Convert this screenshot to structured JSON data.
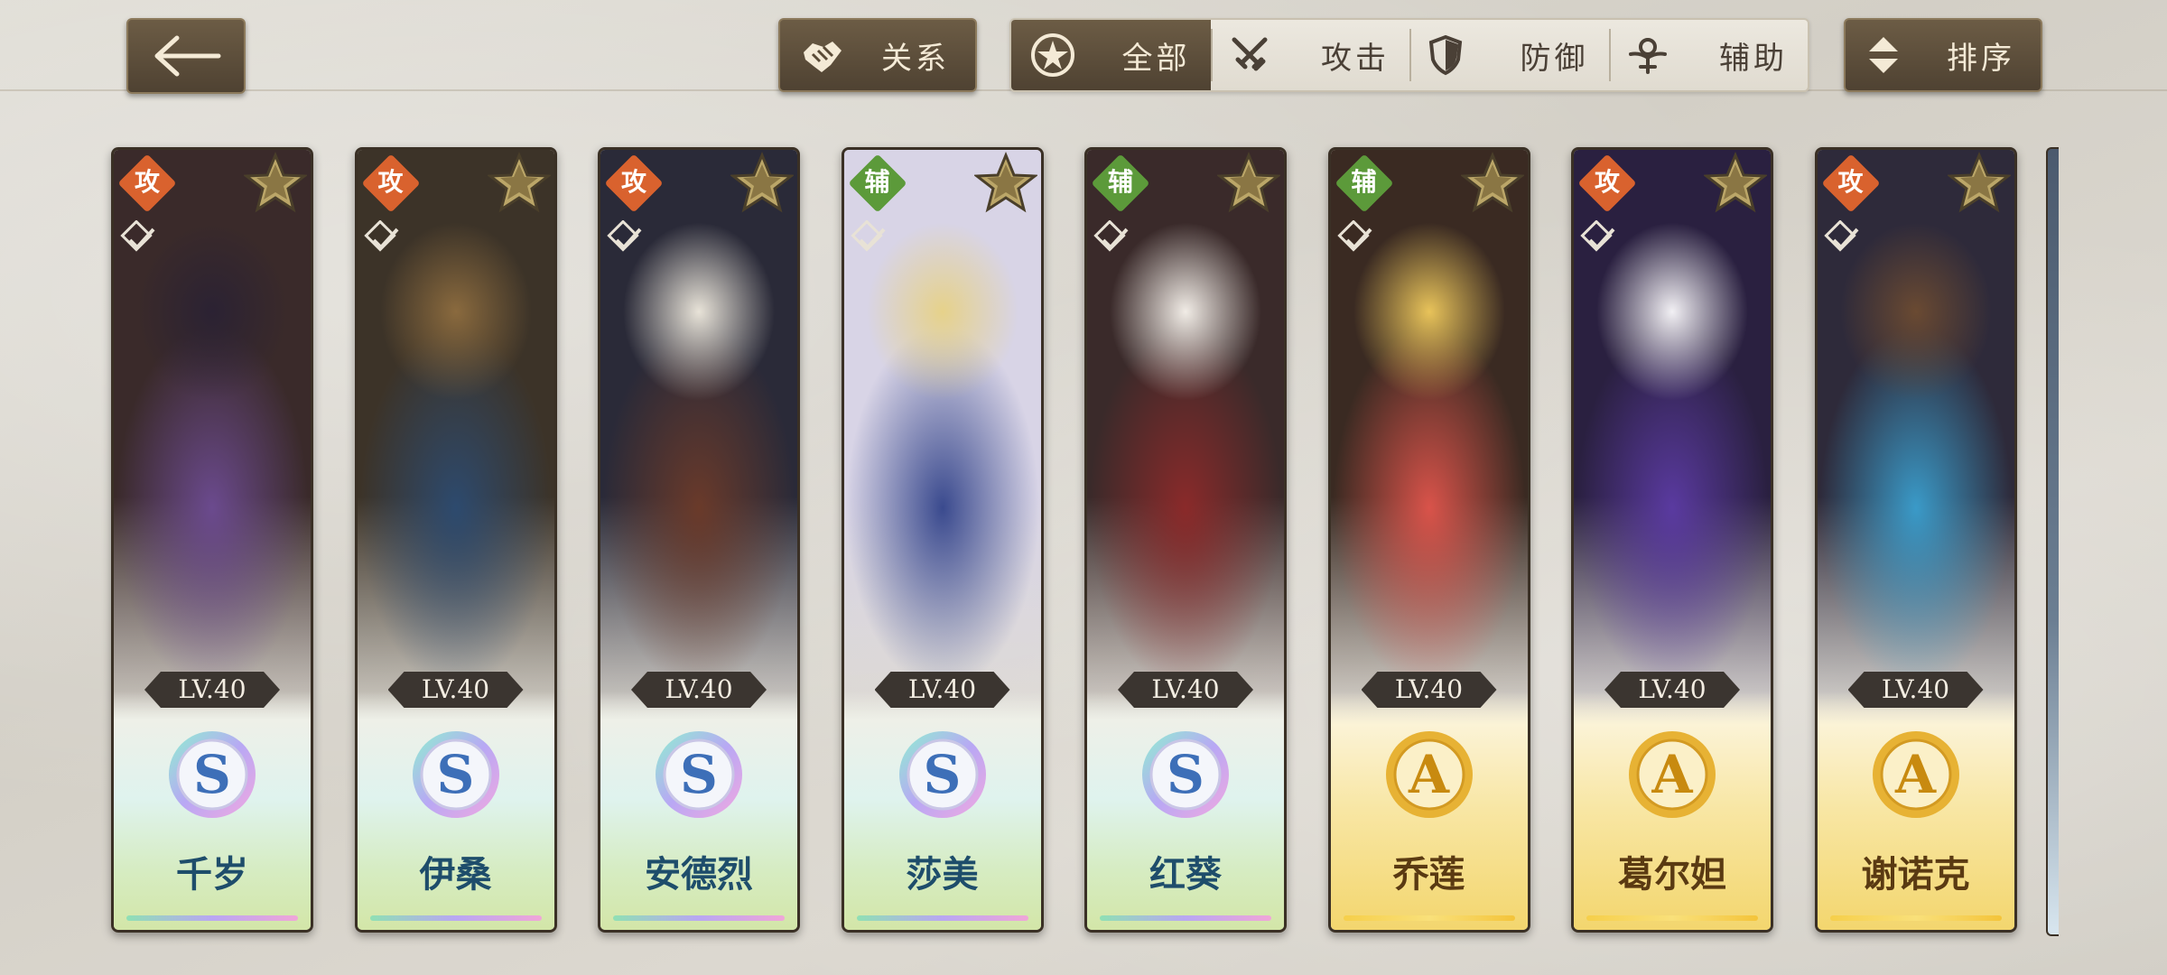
{
  "toolbar": {
    "relation_label": "关系",
    "sort_label": "排序",
    "filters": [
      {
        "label": "全部",
        "icon": "star-circle-icon",
        "active": true
      },
      {
        "label": "攻击",
        "icon": "crossed-swords-icon",
        "active": false
      },
      {
        "label": "防御",
        "icon": "shield-icon",
        "active": false
      },
      {
        "label": "辅助",
        "icon": "support-emblem-icon",
        "active": false
      }
    ]
  },
  "characters": [
    {
      "name": "千岁",
      "level": "LV.40",
      "type": "攻",
      "rank": "S",
      "art_colors": [
        "#3a2a2a",
        "#6b4a8e",
        "#2b2233"
      ]
    },
    {
      "name": "伊桑",
      "level": "LV.40",
      "type": "攻",
      "rank": "S",
      "art_colors": [
        "#3c3328",
        "#2d4a6e",
        "#8a6a3e"
      ]
    },
    {
      "name": "安德烈",
      "level": "LV.40",
      "type": "攻",
      "rank": "S",
      "art_colors": [
        "#2a2a38",
        "#6a3a2a",
        "#e8e3d8"
      ]
    },
    {
      "name": "莎美",
      "level": "LV.40",
      "type": "辅",
      "rank": "S",
      "art_colors": [
        "#d8d4e6",
        "#3a4a8e",
        "#e6d28a"
      ]
    },
    {
      "name": "红葵",
      "level": "LV.40",
      "type": "辅",
      "rank": "S",
      "art_colors": [
        "#3a2a2a",
        "#8a2a2a",
        "#f1ece6"
      ]
    },
    {
      "name": "乔莲",
      "level": "LV.40",
      "type": "辅",
      "rank": "A",
      "art_colors": [
        "#3a2a22",
        "#d9534a",
        "#e8c35a"
      ]
    },
    {
      "name": "葛尔妲",
      "level": "LV.40",
      "type": "攻",
      "rank": "A",
      "art_colors": [
        "#2a2040",
        "#5a3aa0",
        "#f2f0f4"
      ]
    },
    {
      "name": "谢诺克",
      "level": "LV.40",
      "type": "攻",
      "rank": "A",
      "art_colors": [
        "#2e2a3a",
        "#3a9ac8",
        "#6a4a32"
      ]
    }
  ]
}
